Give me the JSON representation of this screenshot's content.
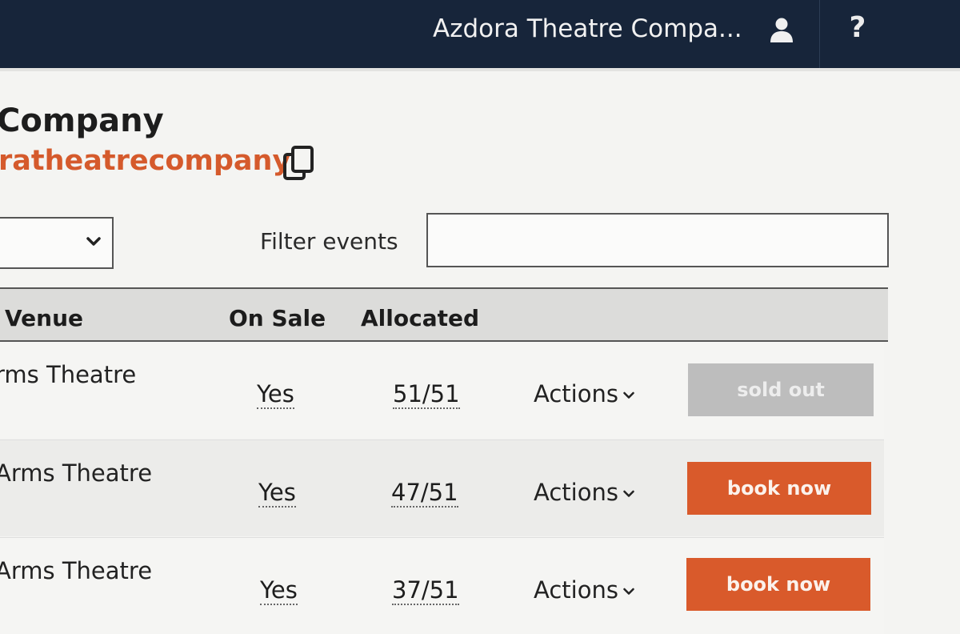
{
  "header": {
    "company_name": "Azdora Theatre Compa...",
    "user_icon": "user-icon",
    "help_label": "?"
  },
  "page": {
    "title": "Company",
    "handle": "ratheatrecompany",
    "copy_icon": "copy-icon"
  },
  "filters": {
    "select_icon": "chevron-down-icon",
    "filter_label": "Filter events",
    "filter_value": ""
  },
  "table": {
    "columns": {
      "venue": "Venue",
      "on_sale": "On Sale",
      "allocated": "Allocated"
    },
    "rows": [
      {
        "venue": "rms Theatre",
        "on_sale": "Yes",
        "allocated": "51/51",
        "actions": "Actions",
        "cta": "sold out",
        "cta_state": "disabled"
      },
      {
        "venue": "Arms Theatre",
        "on_sale": "Yes",
        "allocated": "47/51",
        "actions": "Actions",
        "cta": "book now",
        "cta_state": "active"
      },
      {
        "venue": "Arms Theatre",
        "on_sale": "Yes",
        "allocated": "37/51",
        "actions": "Actions",
        "cta": "book now",
        "cta_state": "active"
      }
    ]
  },
  "colors": {
    "topbar": "#17253a",
    "accent": "#d95a2b",
    "disabled": "#bdbdbd"
  }
}
